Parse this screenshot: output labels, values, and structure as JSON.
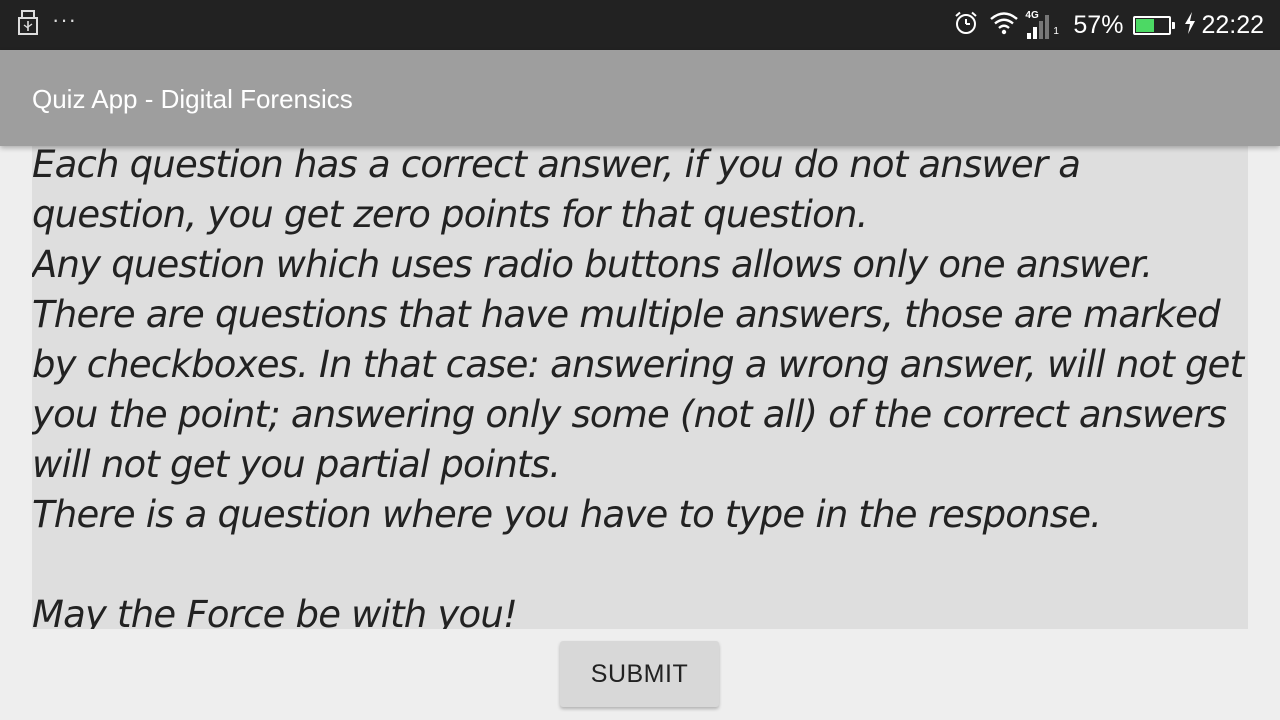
{
  "status_bar": {
    "icons_left": [
      "usb-icon",
      "more-dots-icon"
    ],
    "more_glyph": "···",
    "network_label": "4G",
    "sim_slot": "1",
    "battery_percent": "57%",
    "battery_level": 0.57,
    "time": "22:22",
    "colors": {
      "background": "#222222",
      "battery_fill": "#4cd964"
    }
  },
  "app_bar": {
    "title": "Quiz App - Digital Forensics",
    "background": "#9e9e9e"
  },
  "instructions": {
    "text": "Each question has a correct answer, if you do not answer a question, you get zero points for that question.\nAny question which uses radio buttons allows only one answer.\nThere are questions that have multiple answers, those are marked by checkboxes. In that case: answering a wrong answer, will not get you the point; answering only some (not all) of the correct answers will not get you partial points.\nThere is a question where you have to type in the response.\n\nMay the Force be with you!"
  },
  "submit": {
    "label": "SUBMIT"
  }
}
